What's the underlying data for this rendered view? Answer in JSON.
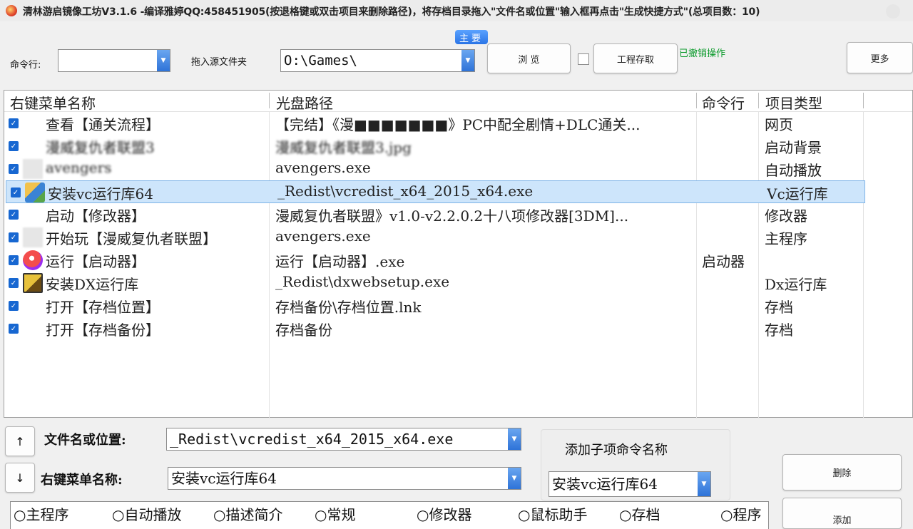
{
  "window": {
    "title": "清林游启镜像工坊V3.1.6 -编译雅婷QQ:458451905(按退格键或双击项目来删除路径)，将存档目录拖入\"文件名或位置\"输入框再点击\"生成快捷方式\"(总项目数：10)"
  },
  "toolbar": {
    "cmd_label": "命令行:",
    "cmd_value": "",
    "source_label": "拖入源文件夹",
    "source_value": "O:\\Games\\",
    "main_badge": "主要",
    "browse_label": "浏 览",
    "project_save_label": "工程存取",
    "undo_status": "已撤销操作",
    "more_label": "更多"
  },
  "list": {
    "columns": [
      "右键菜单名称",
      "光盘路径",
      "命令行",
      "项目类型"
    ],
    "rows": [
      {
        "name": "查看【通关流程】",
        "path": "【完结】《漫■■■■■■■》PC中配全剧情+DLC通关...",
        "cmd": "",
        "type": "网页",
        "icon": "none",
        "blur_name": false,
        "blur_path": false
      },
      {
        "name": "漫威复仇者联盟3",
        "path": "漫威复仇者联盟3.jpg",
        "cmd": "",
        "type": "启动背景",
        "icon": "none",
        "blur_name": true,
        "blur_path": true
      },
      {
        "name": "avengers",
        "path": "avengers.exe",
        "cmd": "",
        "type": "自动播放",
        "icon": "blurred-icon",
        "blur_name": true,
        "blur_path": false
      },
      {
        "name": "安装vc运行库64",
        "path": "_Redist\\vcredist_x64_2015_x64.exe",
        "cmd": "",
        "type": "Vc运行库",
        "icon": "vc-installer-icon",
        "blur_name": false,
        "blur_path": false,
        "selected": true
      },
      {
        "name": "启动【修改器】",
        "path": "漫威复仇者联盟》v1.0-v2.2.0.2十八项修改器[3DM]...",
        "cmd": "",
        "type": "修改器",
        "icon": "none",
        "blur_name": false,
        "blur_path": false
      },
      {
        "name": "开始玩【漫威复仇者联盟】",
        "path": "avengers.exe",
        "cmd": "",
        "type": "主程序",
        "icon": "blurred-icon",
        "blur_name": false,
        "blur_path": false
      },
      {
        "name": "运行【启动器】",
        "path": "运行【启动器】.exe",
        "cmd": "启动器",
        "type": "",
        "icon": "launcher-icon",
        "blur_name": false,
        "blur_path": false
      },
      {
        "name": "安装DX运行库",
        "path": "_Redist\\dxwebsetup.exe",
        "cmd": "",
        "type": "Dx运行库",
        "icon": "dx-installer-icon",
        "blur_name": false,
        "blur_path": false
      },
      {
        "name": "打开【存档位置】",
        "path": "存档备份\\存档位置.lnk",
        "cmd": "",
        "type": "存档",
        "icon": "none",
        "blur_name": false,
        "blur_path": false
      },
      {
        "name": "打开【存档备份】",
        "path": "存档备份",
        "cmd": "",
        "type": "存档",
        "icon": "none",
        "blur_name": false,
        "blur_path": false
      }
    ]
  },
  "editor": {
    "up_label": "↑",
    "down_label": "↓",
    "filename_label": "文件名或位置:",
    "filename_value": "_Redist\\vcredist_x64_2015_x64.exe",
    "menuname_label": "右键菜单名称:",
    "menuname_value": "安装vc运行库64",
    "sub_title": "添加子项命令名称",
    "sub_value": "安装vc运行库64",
    "delete_label": "删除",
    "add_label": "添加"
  },
  "types": [
    "○主程序",
    "○自动播放",
    "○描述简介",
    "○常规",
    "○修改器",
    "○鼠标助手",
    "○存档",
    "○程序"
  ],
  "colors": {
    "accent": "#2a74e6",
    "selection": "#cde5fb",
    "status_green": "#0a9a2a"
  }
}
